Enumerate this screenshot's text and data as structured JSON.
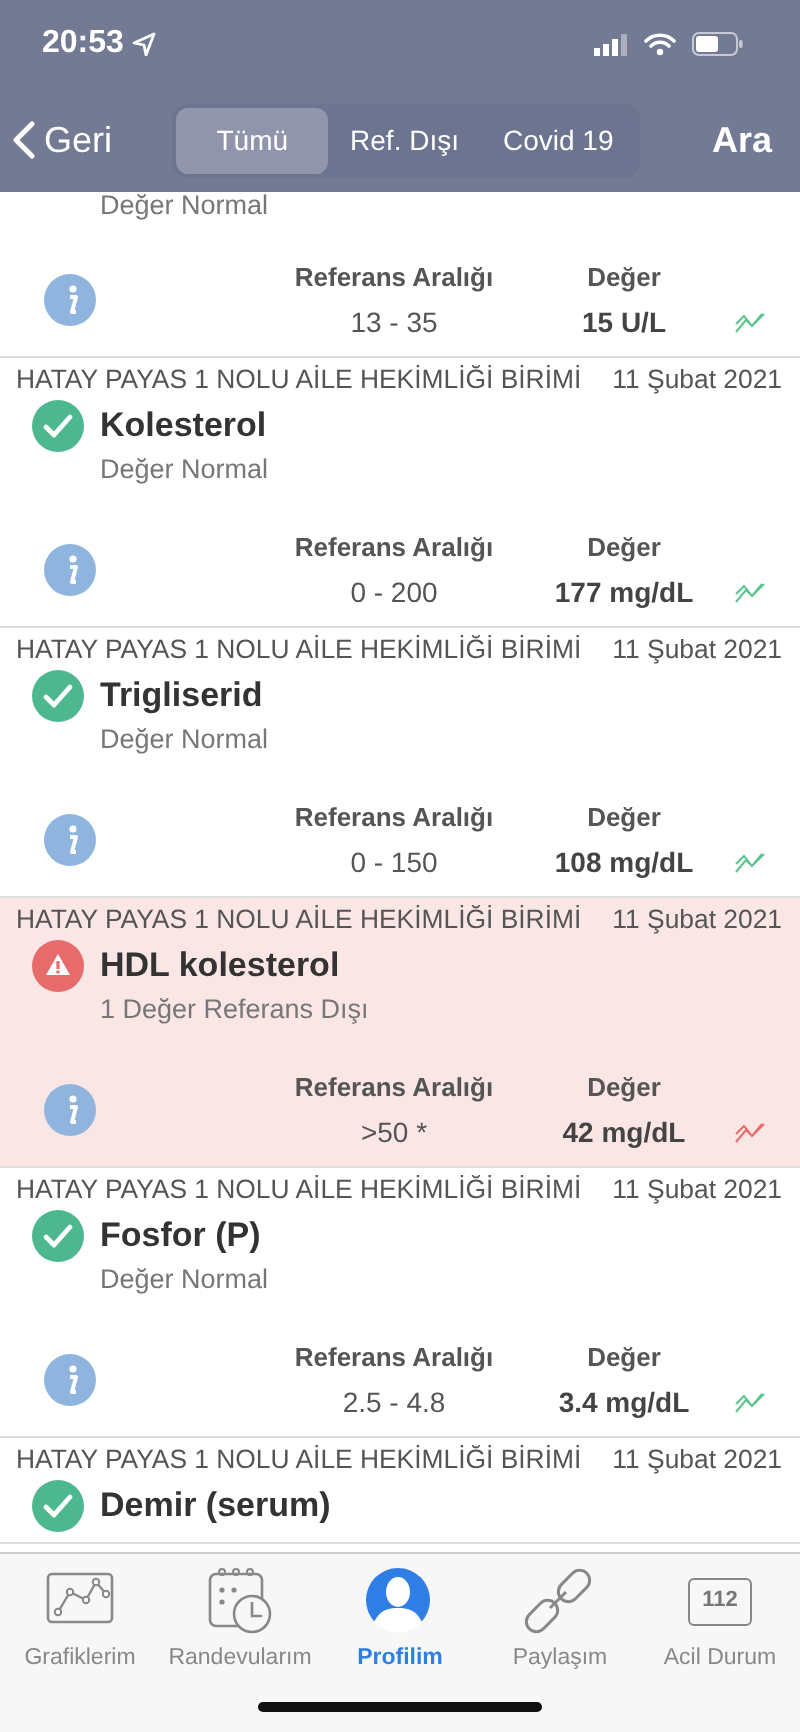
{
  "status_bar": {
    "time": "20:53"
  },
  "nav": {
    "back": "Geri",
    "tabs": [
      {
        "label": "Tümü",
        "selected": true
      },
      {
        "label": "Ref. Dışı",
        "selected": false
      },
      {
        "label": "Covid 19",
        "selected": false
      }
    ],
    "search": "Ara"
  },
  "results": [
    {
      "out_of_range": false,
      "subtitle": "Değer Normal",
      "ref_label": "Referans Aralığı",
      "value_label": "Değer",
      "ref": "13 - 35",
      "value": "15 U/L"
    },
    {
      "facility": "HATAY PAYAS 1 NOLU AİLE HEKİMLİĞİ BİRİMİ",
      "date": "11 Şubat 2021",
      "test": "Kolesterol",
      "out_of_range": false,
      "subtitle": "Değer Normal",
      "ref_label": "Referans Aralığı",
      "value_label": "Değer",
      "ref": "0 - 200",
      "value": "177 mg/dL"
    },
    {
      "facility": "HATAY PAYAS 1 NOLU AİLE HEKİMLİĞİ BİRİMİ",
      "date": "11 Şubat 2021",
      "test": "Trigliserid",
      "out_of_range": false,
      "subtitle": "Değer Normal",
      "ref_label": "Referans Aralığı",
      "value_label": "Değer",
      "ref": "0 - 150",
      "value": "108 mg/dL"
    },
    {
      "facility": "HATAY PAYAS 1 NOLU AİLE HEKİMLİĞİ BİRİMİ",
      "date": "11 Şubat 2021",
      "test": "HDL kolesterol",
      "out_of_range": true,
      "subtitle": "1 Değer Referans Dışı",
      "ref_label": "Referans Aralığı",
      "value_label": "Değer",
      "ref": ">50 *",
      "value": "42 mg/dL"
    },
    {
      "facility": "HATAY PAYAS 1 NOLU AİLE HEKİMLİĞİ BİRİMİ",
      "date": "11 Şubat 2021",
      "test": "Fosfor (P)",
      "out_of_range": false,
      "subtitle": "Değer Normal",
      "ref_label": "Referans Aralığı",
      "value_label": "Değer",
      "ref": "2.5 - 4.8",
      "value": "3.4 mg/dL"
    },
    {
      "facility": "HATAY PAYAS 1 NOLU AİLE HEKİMLİĞİ BİRİMİ",
      "date": "11 Şubat 2021",
      "test": "Demir (serum)",
      "out_of_range": false
    }
  ],
  "tab_bar": [
    {
      "kind": "chart",
      "label": "Grafiklerim",
      "selected": false
    },
    {
      "kind": "calendar",
      "label": "Randevularım",
      "selected": false
    },
    {
      "kind": "profile",
      "label": "Profilim",
      "selected": true
    },
    {
      "kind": "link",
      "label": "Paylaşım",
      "selected": false
    },
    {
      "kind": "emergency",
      "label": "Acil Durum",
      "icon_text": "112",
      "selected": false
    }
  ]
}
